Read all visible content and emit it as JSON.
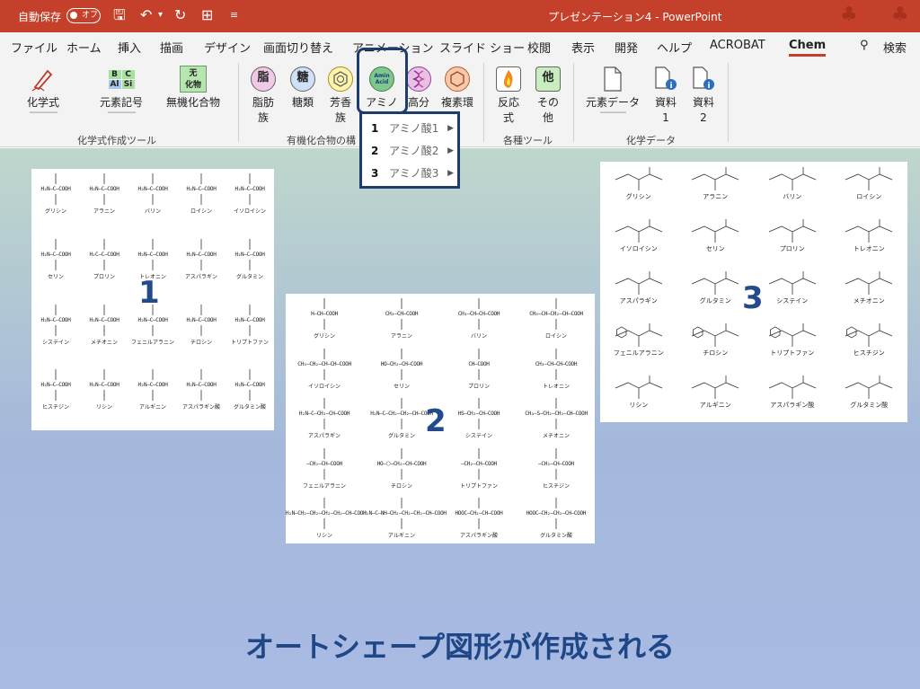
{
  "titlebar": {
    "autosave_label": "自動保存",
    "autosave_state": "オフ",
    "title": "プレゼンテーション4  -  PowerPoint"
  },
  "menu": {
    "items": [
      "ファイル",
      "ホーム",
      "挿入",
      "描画",
      "デザイン",
      "画面切り替え",
      "アニメーション",
      "スライド ショー",
      "校閲",
      "表示",
      "開発",
      "ヘルプ",
      "ACROBAT",
      "Chem"
    ],
    "active": "Chem",
    "search_label": "検索"
  },
  "ribbon": {
    "formula_tools": {
      "chemical_formula": "化学式",
      "element_symbol": "元素記号",
      "inorganic_compound": "無機化合物",
      "element_tile": [
        "B",
        "C",
        "Al",
        "Si"
      ],
      "inorganic_icon_top": "无",
      "inorganic_icon_bottom": "化物",
      "group_label": "化学式作成ツール"
    },
    "organic": {
      "aliphatic_icon": "脂",
      "aliphatic_l1": "脂肪",
      "aliphatic_l2": "族",
      "sugar_icon": "糖",
      "sugar_l1": "糖類",
      "aromatic_l1": "芳香",
      "aromatic_l2": "族",
      "amino_icon_l1": "Amin",
      "amino_icon_l2": "Acid",
      "amino_label": "アミノ",
      "polymer_label": "高分",
      "heterocycle_label": "複素環",
      "group_label": "有機化合物の構"
    },
    "misc": {
      "reaction_l1": "反応",
      "reaction_l2": "式",
      "other_icon": "他",
      "other_l1": "その",
      "other_l2": "他",
      "group_label": "各種ツール"
    },
    "chemdata": {
      "element_data": "元素データ",
      "material1_l1": "資料",
      "material1_l2": "1",
      "material2_l1": "資料",
      "material2_l2": "2",
      "group_label": "化学データ"
    }
  },
  "dropdown": {
    "items": [
      {
        "num": "1",
        "label": "アミノ酸1"
      },
      {
        "num": "2",
        "label": "アミノ酸2"
      },
      {
        "num": "3",
        "label": "アミノ酸3"
      }
    ]
  },
  "panel1": {
    "number": "1",
    "amino_acids": [
      {
        "name": "グリシン",
        "formula": "H₂N—C—COOH"
      },
      {
        "name": "アラニン",
        "formula": "H₂N—C—COOH"
      },
      {
        "name": "バリン",
        "formula": "H₂N—C—COOH"
      },
      {
        "name": "ロイシン",
        "formula": "H₂N—C—COOH"
      },
      {
        "name": "イソロイシン",
        "formula": "H₂N—C—COOH"
      },
      {
        "name": "セリン",
        "formula": "H₂N—C—COOH"
      },
      {
        "name": "プロリン",
        "formula": "H₂C—C—COOH"
      },
      {
        "name": "トレオニン",
        "formula": "H₂N—C—COOH"
      },
      {
        "name": "アスパラギン",
        "formula": "H₂N—C—COOH"
      },
      {
        "name": "グルタミン",
        "formula": "H₂N—C—COOH"
      },
      {
        "name": "システイン",
        "formula": "H₂N—C—COOH"
      },
      {
        "name": "メチオニン",
        "formula": "H₂N—C—COOH"
      },
      {
        "name": "フェニルアラニン",
        "formula": "H₂N—C—COOH"
      },
      {
        "name": "チロシン",
        "formula": "H₂N—C—COOH"
      },
      {
        "name": "トリプトファン",
        "formula": "H₂N—C—COOH"
      },
      {
        "name": "ヒスチジン",
        "formula": "H₂N—C—COOH"
      },
      {
        "name": "リシン",
        "formula": "H₂N—C—COOH"
      },
      {
        "name": "アルギニン",
        "formula": "H₂N—C—COOH"
      },
      {
        "name": "アスパラギン酸",
        "formula": "H₂N—C—COOH"
      },
      {
        "name": "グルタミン酸",
        "formula": "H₂N—C—COOH"
      }
    ]
  },
  "panel2": {
    "number": "2",
    "amino_acids": [
      {
        "name": "グリシン",
        "formula": "H—CH—COOH"
      },
      {
        "name": "アラニン",
        "formula": "CH₃—CH—COOH"
      },
      {
        "name": "バリン",
        "formula": "CH₃—CH—CH—COOH"
      },
      {
        "name": "ロイシン",
        "formula": "CH₃—CH—CH₂—CH—COOH"
      },
      {
        "name": "イソロイシン",
        "formula": "CH₃—CH₂—CH—CH—COOH"
      },
      {
        "name": "セリン",
        "formula": "HO—CH₂—CH—COOH"
      },
      {
        "name": "プロリン",
        "formula": "CH—COOH"
      },
      {
        "name": "トレオニン",
        "formula": "CH₃—CH—CH—COOH"
      },
      {
        "name": "アスパラギン",
        "formula": "H₂N—C—CH₂—CH—COOH"
      },
      {
        "name": "グルタミン",
        "formula": "H₂N—C—CH₂—CH₂—CH—COOH"
      },
      {
        "name": "システイン",
        "formula": "HS—CH₂—CH—COOH"
      },
      {
        "name": "メチオニン",
        "formula": "CH₃—S—CH₂—CH₂—CH—COOH"
      },
      {
        "name": "フェニルアラニン",
        "formula": "—CH₂—CH—COOH"
      },
      {
        "name": "チロシン",
        "formula": "HO—⬡—CH₂—CH—COOH"
      },
      {
        "name": "トリプトファン",
        "formula": "—CH₂—CH—COOH"
      },
      {
        "name": "ヒスチジン",
        "formula": "—CH₂—CH—COOH"
      },
      {
        "name": "リシン",
        "formula": "H₂N—CH₂—CH₂—CH₂—CH₂—CH—COOH"
      },
      {
        "name": "アルギニン",
        "formula": "H₂N—C—NH—CH₂—CH₂—CH₂—CH—COOH"
      },
      {
        "name": "アスパラギン酸",
        "formula": "HOOC—CH₂—CH—COOH"
      },
      {
        "name": "グルタミン酸",
        "formula": "HOOC—CH₂—CH₂—CH—COOH"
      }
    ]
  },
  "panel3": {
    "number": "3",
    "amino_acids": [
      {
        "name": "グリシン"
      },
      {
        "name": "アラニン"
      },
      {
        "name": "バリン"
      },
      {
        "name": "ロイシン"
      },
      {
        "name": "イソロイシン"
      },
      {
        "name": "セリン"
      },
      {
        "name": "プロリン"
      },
      {
        "name": "トレオニン"
      },
      {
        "name": "アスパラギン"
      },
      {
        "name": "グルタミン"
      },
      {
        "name": "システイン"
      },
      {
        "name": "メチオニン"
      },
      {
        "name": "フェニルアラニン"
      },
      {
        "name": "チロシン"
      },
      {
        "name": "トリプトファン"
      },
      {
        "name": "ヒスチジン"
      },
      {
        "name": "リシン"
      },
      {
        "name": "アルギニン"
      },
      {
        "name": "アスパラギン酸"
      },
      {
        "name": "グルタミン酸"
      }
    ]
  },
  "caption": "オートシェープ図形が作成される",
  "colors": {
    "titlebar": "#c4402a",
    "highlight": "#1f3c6e",
    "caption": "#1f4687",
    "panel_number": "#234b8c"
  }
}
